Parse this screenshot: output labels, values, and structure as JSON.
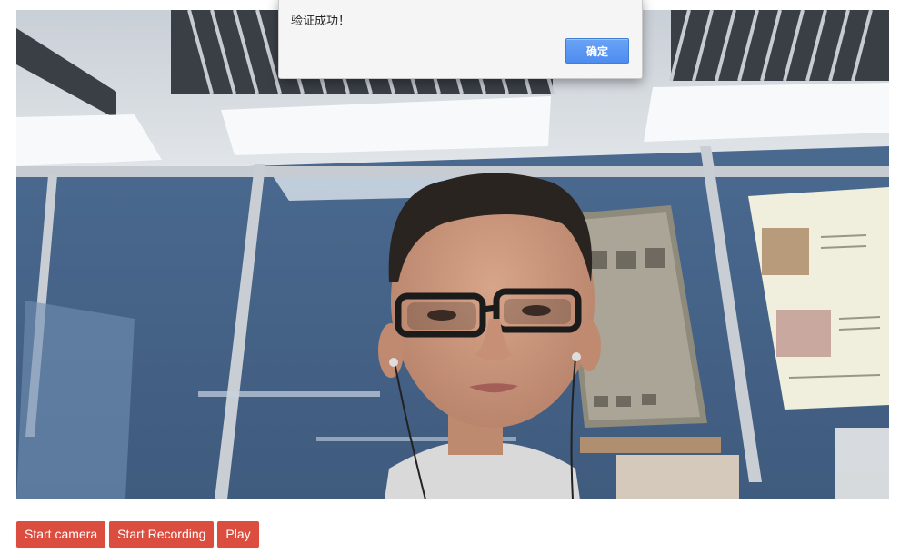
{
  "alert": {
    "message": "验证成功！",
    "ok_label": "确定"
  },
  "controls": {
    "start_camera_label": "Start camera",
    "start_recording_label": "Start Recording",
    "play_label": "Play"
  },
  "colors": {
    "button_red": "#db4e3f",
    "dialog_blue": "#4d8cf0"
  }
}
